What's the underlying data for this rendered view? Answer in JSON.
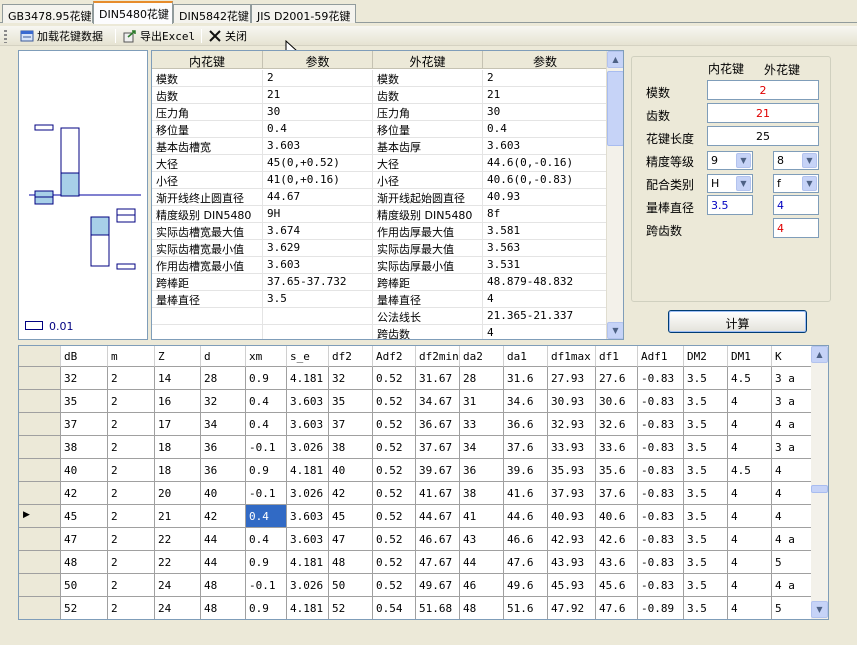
{
  "tabs": [
    "GB3478.95花键",
    "DIN5480花键",
    "DIN5842花键",
    "JIS D2001-59花键"
  ],
  "active_tab": 1,
  "toolbar": {
    "load": "加载花键数据",
    "export": "导出Excel",
    "close": "关闭"
  },
  "diagram": {
    "scale_label": "0.01"
  },
  "prop_grid": {
    "headers": [
      "内花键",
      "参数",
      "外花键",
      "参数"
    ],
    "rows": [
      [
        "模数",
        "2",
        "模数",
        "2"
      ],
      [
        "齿数",
        "21",
        "齿数",
        "21"
      ],
      [
        "压力角",
        "30",
        "压力角",
        "30"
      ],
      [
        "移位量",
        "0.4",
        "移位量",
        "0.4"
      ],
      [
        "基本齿槽宽",
        "3.603",
        "基本齿厚",
        "3.603"
      ],
      [
        "大径",
        "45(0,+0.52)",
        "大径",
        "44.6(0,-0.16)"
      ],
      [
        "小径",
        "41(0,+0.16)",
        "小径",
        "40.6(0,-0.83)"
      ],
      [
        "渐开线终止圆直径",
        "44.67",
        "渐开线起始圆直径",
        "40.93"
      ],
      [
        "精度级别 DIN5480",
        "9H",
        "精度级别 DIN5480",
        "8f"
      ],
      [
        "实际齿槽宽最大值",
        "3.674",
        "作用齿厚最大值",
        "3.581"
      ],
      [
        "实际齿槽宽最小值",
        "3.629",
        "实际齿厚最大值",
        "3.563"
      ],
      [
        "作用齿槽宽最小值",
        "3.603",
        "实际齿厚最小值",
        "3.531"
      ],
      [
        "跨棒距",
        "37.65-37.732",
        "跨棒距",
        "48.879-48.832"
      ],
      [
        "量棒直径",
        "3.5",
        "量棒直径",
        "4"
      ],
      [
        "",
        "",
        "公法线长",
        "21.365-21.337"
      ],
      [
        "",
        "",
        "跨齿数",
        "4"
      ]
    ]
  },
  "right_panel": {
    "col_inner": "内花键",
    "col_outer": "外花键",
    "labels": {
      "module": "模数",
      "teeth": "齿数",
      "length": "花键长度",
      "precision": "精度等级",
      "fit": "配合类别",
      "pin": "量棒直径",
      "span": "跨齿数"
    },
    "module": "2",
    "teeth": "21",
    "length": "25",
    "precision_inner": "9",
    "precision_outer": "8",
    "fit_inner": "H",
    "fit_outer": "f",
    "pin_inner": "3.5",
    "pin_outer": "4",
    "span_outer": "4",
    "calc": "计算",
    "colors": {
      "value_red": "#e00000",
      "value_blue": "#0000c0"
    }
  },
  "data_grid": {
    "headers": [
      "dB",
      "m",
      "Z",
      "d",
      "xm",
      "s_e",
      "df2",
      "Adf2",
      "df2min",
      "da2",
      "da1",
      "df1max",
      "df1",
      "Adf1",
      "DM2",
      "DM1",
      "K"
    ],
    "rows": [
      [
        "32",
        "2",
        "14",
        "28",
        "0.9",
        "4.181",
        "32",
        "0.52",
        "31.67",
        "28",
        "31.6",
        "27.93",
        "27.6",
        "-0.83",
        "3.5",
        "4.5",
        "3 a"
      ],
      [
        "35",
        "2",
        "16",
        "32",
        "0.4",
        "3.603",
        "35",
        "0.52",
        "34.67",
        "31",
        "34.6",
        "30.93",
        "30.6",
        "-0.83",
        "3.5",
        "4",
        "3 a"
      ],
      [
        "37",
        "2",
        "17",
        "34",
        "0.4",
        "3.603",
        "37",
        "0.52",
        "36.67",
        "33",
        "36.6",
        "32.93",
        "32.6",
        "-0.83",
        "3.5",
        "4",
        "4 a"
      ],
      [
        "38",
        "2",
        "18",
        "36",
        "-0.1",
        "3.026",
        "38",
        "0.52",
        "37.67",
        "34",
        "37.6",
        "33.93",
        "33.6",
        "-0.83",
        "3.5",
        "4",
        "3 a"
      ],
      [
        "40",
        "2",
        "18",
        "36",
        "0.9",
        "4.181",
        "40",
        "0.52",
        "39.67",
        "36",
        "39.6",
        "35.93",
        "35.6",
        "-0.83",
        "3.5",
        "4.5",
        "4"
      ],
      [
        "42",
        "2",
        "20",
        "40",
        "-0.1",
        "3.026",
        "42",
        "0.52",
        "41.67",
        "38",
        "41.6",
        "37.93",
        "37.6",
        "-0.83",
        "3.5",
        "4",
        "4"
      ],
      [
        "45",
        "2",
        "21",
        "42",
        "0.4",
        "3.603",
        "45",
        "0.52",
        "44.67",
        "41",
        "44.6",
        "40.93",
        "40.6",
        "-0.83",
        "3.5",
        "4",
        "4"
      ],
      [
        "47",
        "2",
        "22",
        "44",
        "0.4",
        "3.603",
        "47",
        "0.52",
        "46.67",
        "43",
        "46.6",
        "42.93",
        "42.6",
        "-0.83",
        "3.5",
        "4",
        "4 a"
      ],
      [
        "48",
        "2",
        "22",
        "44",
        "0.9",
        "4.181",
        "48",
        "0.52",
        "47.67",
        "44",
        "47.6",
        "43.93",
        "43.6",
        "-0.83",
        "3.5",
        "4",
        "5"
      ],
      [
        "50",
        "2",
        "24",
        "48",
        "-0.1",
        "3.026",
        "50",
        "0.52",
        "49.67",
        "46",
        "49.6",
        "45.93",
        "45.6",
        "-0.83",
        "3.5",
        "4",
        "4 a"
      ],
      [
        "52",
        "2",
        "24",
        "48",
        "0.9",
        "4.181",
        "52",
        "0.54",
        "51.68",
        "48",
        "51.6",
        "47.92",
        "47.6",
        "-0.89",
        "3.5",
        "4",
        "5"
      ]
    ],
    "selected_row": 6,
    "selected_col": 4
  }
}
